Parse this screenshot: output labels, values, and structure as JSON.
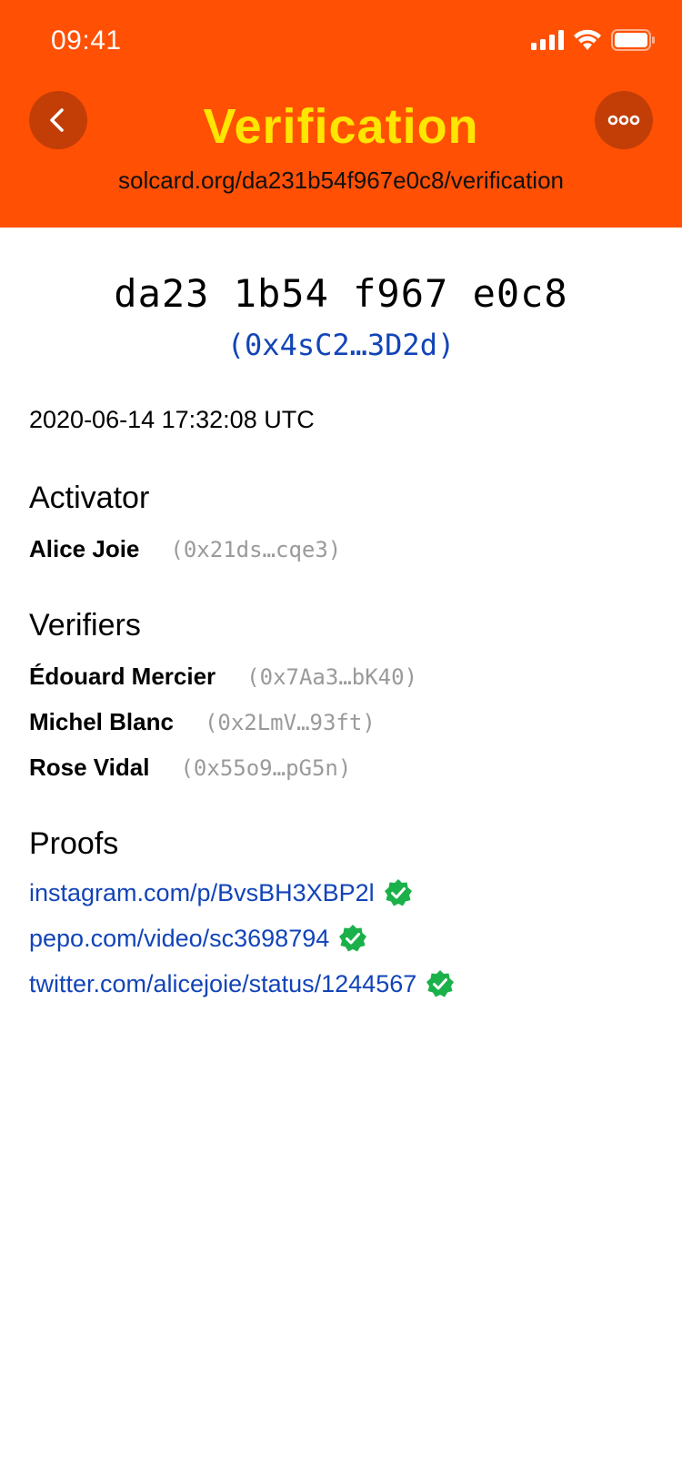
{
  "status_bar": {
    "time": "09:41",
    "icons": [
      "cellular-signal-icon",
      "wifi-icon",
      "battery-icon"
    ]
  },
  "header": {
    "title": "Verification",
    "url": "solcard.org/da231b54f967e0c8/verification",
    "back_icon": "chevron-left-icon",
    "more_icon": "ellipsis-icon",
    "colors": {
      "background": "#ff5004",
      "title": "#ffe600",
      "button": "#c33e07"
    }
  },
  "card": {
    "id": "da23 1b54 f967 e0c8",
    "address": "(0x4sC2…3D2d)",
    "timestamp": "2020-06-14 17:32:08 UTC"
  },
  "activator": {
    "heading": "Activator",
    "name": "Alice Joie",
    "address": "(0x21ds…cqe3)"
  },
  "verifiers": {
    "heading": "Verifiers",
    "items": [
      {
        "name": "Édouard Mercier",
        "address": "(0x7Aa3…bK40)"
      },
      {
        "name": "Michel Blanc",
        "address": "(0x2LmV…93ft)"
      },
      {
        "name": "Rose Vidal",
        "address": "(0x55o9…pG5n)"
      }
    ]
  },
  "proofs": {
    "heading": "Proofs",
    "items": [
      {
        "url": "instagram.com/p/BvsBH3XBP2l",
        "verified": true
      },
      {
        "url": "pepo.com/video/sc3698794",
        "verified": true
      },
      {
        "url": "twitter.com/alicejoie/status/1244567",
        "verified": true
      }
    ],
    "verified_color": "#1bb14a",
    "link_color": "#1244b8"
  }
}
